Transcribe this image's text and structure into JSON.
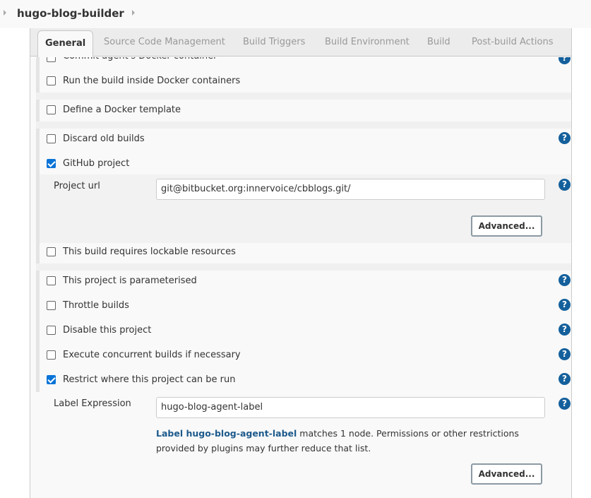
{
  "breadcrumb": {
    "project": "hugo-blog-builder"
  },
  "tabs": [
    {
      "label": "General",
      "active": true
    },
    {
      "label": "Source Code Management",
      "active": false
    },
    {
      "label": "Build Triggers",
      "active": false
    },
    {
      "label": "Build Environment",
      "active": false
    },
    {
      "label": "Build",
      "active": false
    },
    {
      "label": "Post-build Actions",
      "active": false
    }
  ],
  "options": {
    "commit_docker": {
      "label": "Commit agent's Docker container",
      "checked": false
    },
    "run_in_docker": {
      "label": "Run the build inside Docker containers",
      "checked": false
    },
    "docker_template": {
      "label": "Define a Docker template",
      "checked": false
    },
    "discard_old": {
      "label": "Discard old builds",
      "checked": false
    },
    "github_project": {
      "label": "GitHub project",
      "checked": true
    },
    "lockable": {
      "label": "This build requires lockable resources",
      "checked": false
    },
    "parameterised": {
      "label": "This project is parameterised",
      "checked": false
    },
    "throttle": {
      "label": "Throttle builds",
      "checked": false
    },
    "disable": {
      "label": "Disable this project",
      "checked": false
    },
    "concurrent": {
      "label": "Execute concurrent builds if necessary",
      "checked": false
    },
    "restrict": {
      "label": "Restrict where this project can be run",
      "checked": true
    }
  },
  "project_url": {
    "label": "Project url",
    "value": "git@bitbucket.org:innervoice/cbblogs.git/"
  },
  "label_expression": {
    "label": "Label Expression",
    "value": "hugo-blog-agent-label",
    "info_link": "Label hugo-blog-agent-label",
    "info_text": " matches 1 node. Permissions or other restrictions provided by plugins may further reduce that list."
  },
  "buttons": {
    "advanced": "Advanced..."
  },
  "help_icon": "?",
  "colors": {
    "checkbox_checked": "#0a74d8",
    "help_icon": "#14609c",
    "link": "#1d5a8c"
  }
}
